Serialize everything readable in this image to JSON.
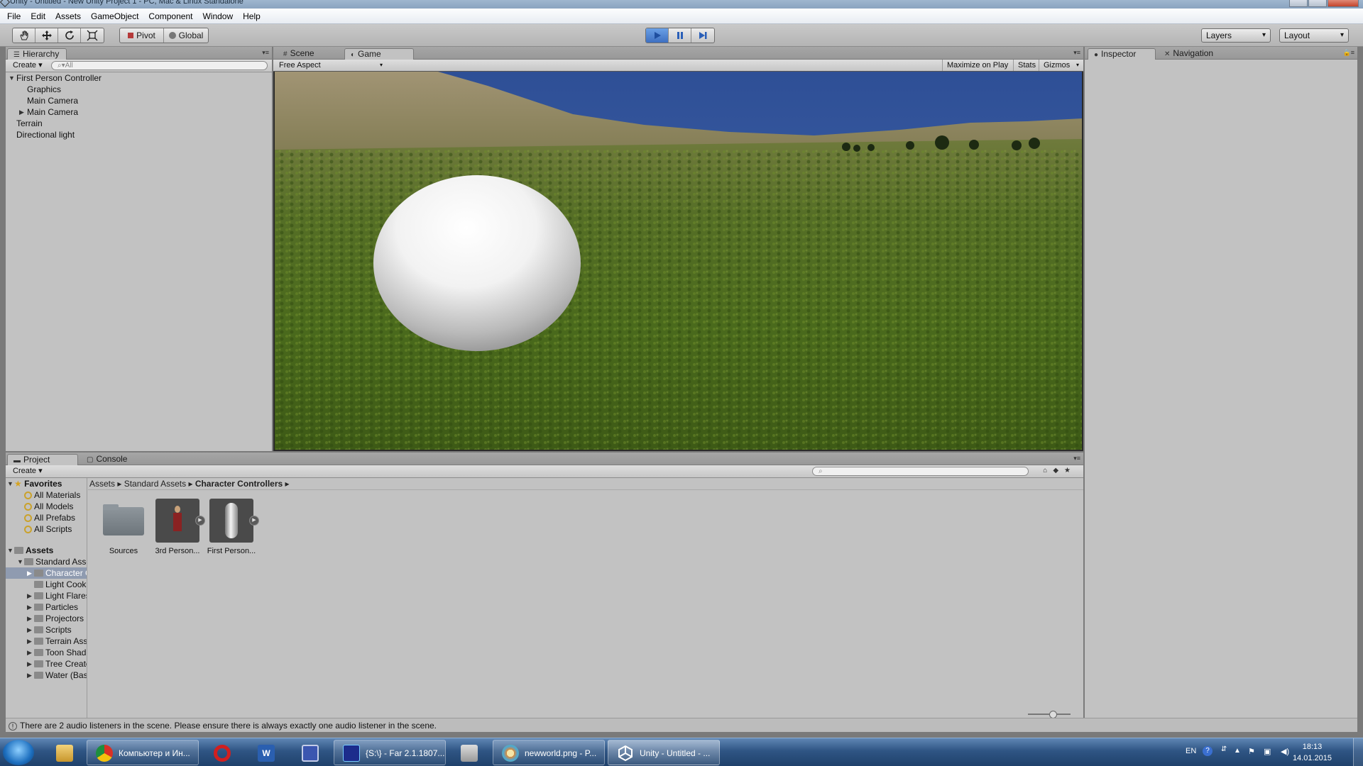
{
  "window": {
    "title": "Unity - Untitled - New Unity Project 1 - PC, Mac & Linux Standalone"
  },
  "menu": [
    "File",
    "Edit",
    "Assets",
    "GameObject",
    "Component",
    "Window",
    "Help"
  ],
  "toolbar": {
    "pivot": "Pivot",
    "global": "Global",
    "layers": "Layers",
    "layout": "Layout",
    "play_active": true
  },
  "hierarchy": {
    "tab": "Hierarchy",
    "create": "Create",
    "search_placeholder": "All",
    "items": [
      {
        "label": "First Person Controller",
        "indent": 0,
        "expanded": true
      },
      {
        "label": "Graphics",
        "indent": 1
      },
      {
        "label": "Main Camera",
        "indent": 1
      },
      {
        "label": "Main Camera",
        "indent": 1,
        "collapsed": true
      },
      {
        "label": "Terrain",
        "indent": 0
      },
      {
        "label": "Directional light",
        "indent": 0
      }
    ]
  },
  "view": {
    "scene_tab": "Scene",
    "game_tab": "Game",
    "aspect": "Free Aspect",
    "maximize": "Maximize on Play",
    "stats": "Stats",
    "gizmos": "Gizmos"
  },
  "inspector": {
    "tab": "Inspector",
    "nav_tab": "Navigation"
  },
  "project": {
    "tab": "Project",
    "console_tab": "Console",
    "create": "Create",
    "breadcrumb": [
      "Assets",
      "Standard Assets",
      "Character Controllers"
    ],
    "favorites_label": "Favorites",
    "favorites": [
      "All Materials",
      "All Models",
      "All Prefabs",
      "All Scripts"
    ],
    "assets_label": "Assets",
    "tree": [
      {
        "label": "Standard Assets",
        "indent": 1,
        "expanded": true
      },
      {
        "label": "Character Controllers",
        "indent": 2,
        "selected": true
      },
      {
        "label": "Light Cookies",
        "indent": 2
      },
      {
        "label": "Light Flares",
        "indent": 2
      },
      {
        "label": "Particles",
        "indent": 2
      },
      {
        "label": "Projectors",
        "indent": 2
      },
      {
        "label": "Scripts",
        "indent": 2
      },
      {
        "label": "Terrain Assets",
        "indent": 2
      },
      {
        "label": "Toon Shading",
        "indent": 2
      },
      {
        "label": "Tree Creator",
        "indent": 2
      },
      {
        "label": "Water (Basic)",
        "indent": 2
      }
    ],
    "assets": [
      {
        "label": "Sources",
        "kind": "folder"
      },
      {
        "label": "3rd Person...",
        "kind": "prefab-character"
      },
      {
        "label": "First Person...",
        "kind": "prefab-capsule"
      }
    ]
  },
  "status": {
    "message": "There are 2 audio listeners in the scene. Please ensure there is always exactly one audio listener in the scene."
  },
  "taskbar": {
    "items": [
      {
        "label": "",
        "kind": "explorer"
      },
      {
        "label": "Компьютер и Ин...",
        "kind": "chrome"
      },
      {
        "label": "",
        "kind": "opera"
      },
      {
        "label": "",
        "kind": "word"
      },
      {
        "label": "",
        "kind": "save"
      },
      {
        "label": "{S:\\} - Far 2.1.1807...",
        "kind": "far"
      },
      {
        "label": "",
        "kind": "files"
      },
      {
        "label": "newworld.png - P...",
        "kind": "paint"
      },
      {
        "label": "Unity - Untitled - ...",
        "kind": "unity",
        "active": true
      }
    ],
    "lang": "EN",
    "time": "18:13",
    "date": "14.01.2015"
  }
}
